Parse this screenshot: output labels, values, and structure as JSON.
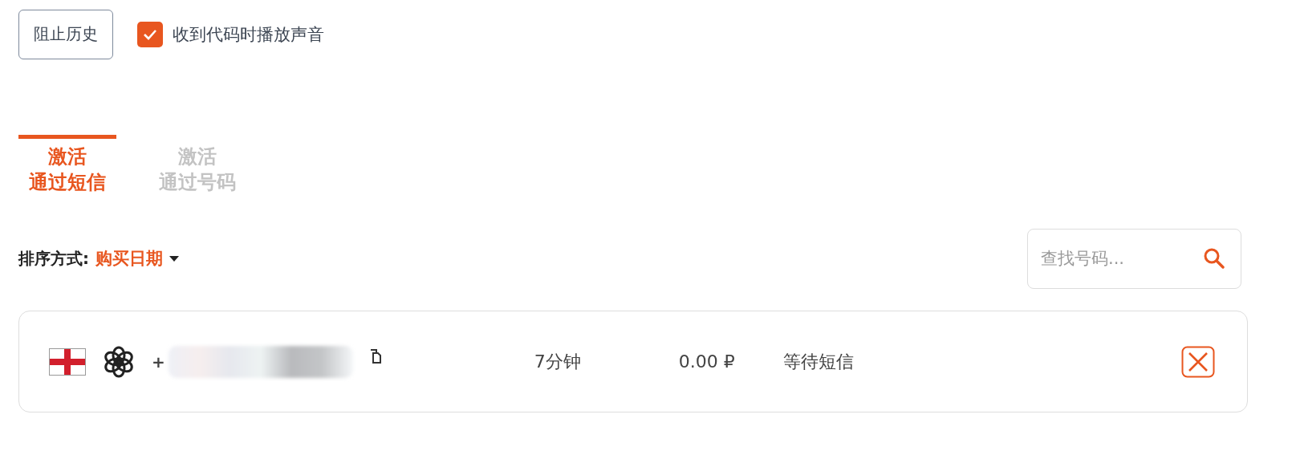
{
  "block_history_button": "阻止历史",
  "sound_option": {
    "label": "收到代码时播放声音",
    "checked": true
  },
  "tabs": [
    {
      "lines": [
        "激活",
        "通过短信"
      ],
      "selected": true
    },
    {
      "lines": [
        "激活",
        "通过号码"
      ],
      "selected": false
    }
  ],
  "sort": {
    "label": "排序方式:",
    "value": "购买日期"
  },
  "search": {
    "placeholder": "查找号码..."
  },
  "activations": [
    {
      "phone": "+",
      "time": "7分钟",
      "price": "0.00 ₽",
      "status": "等待短信"
    }
  ]
}
